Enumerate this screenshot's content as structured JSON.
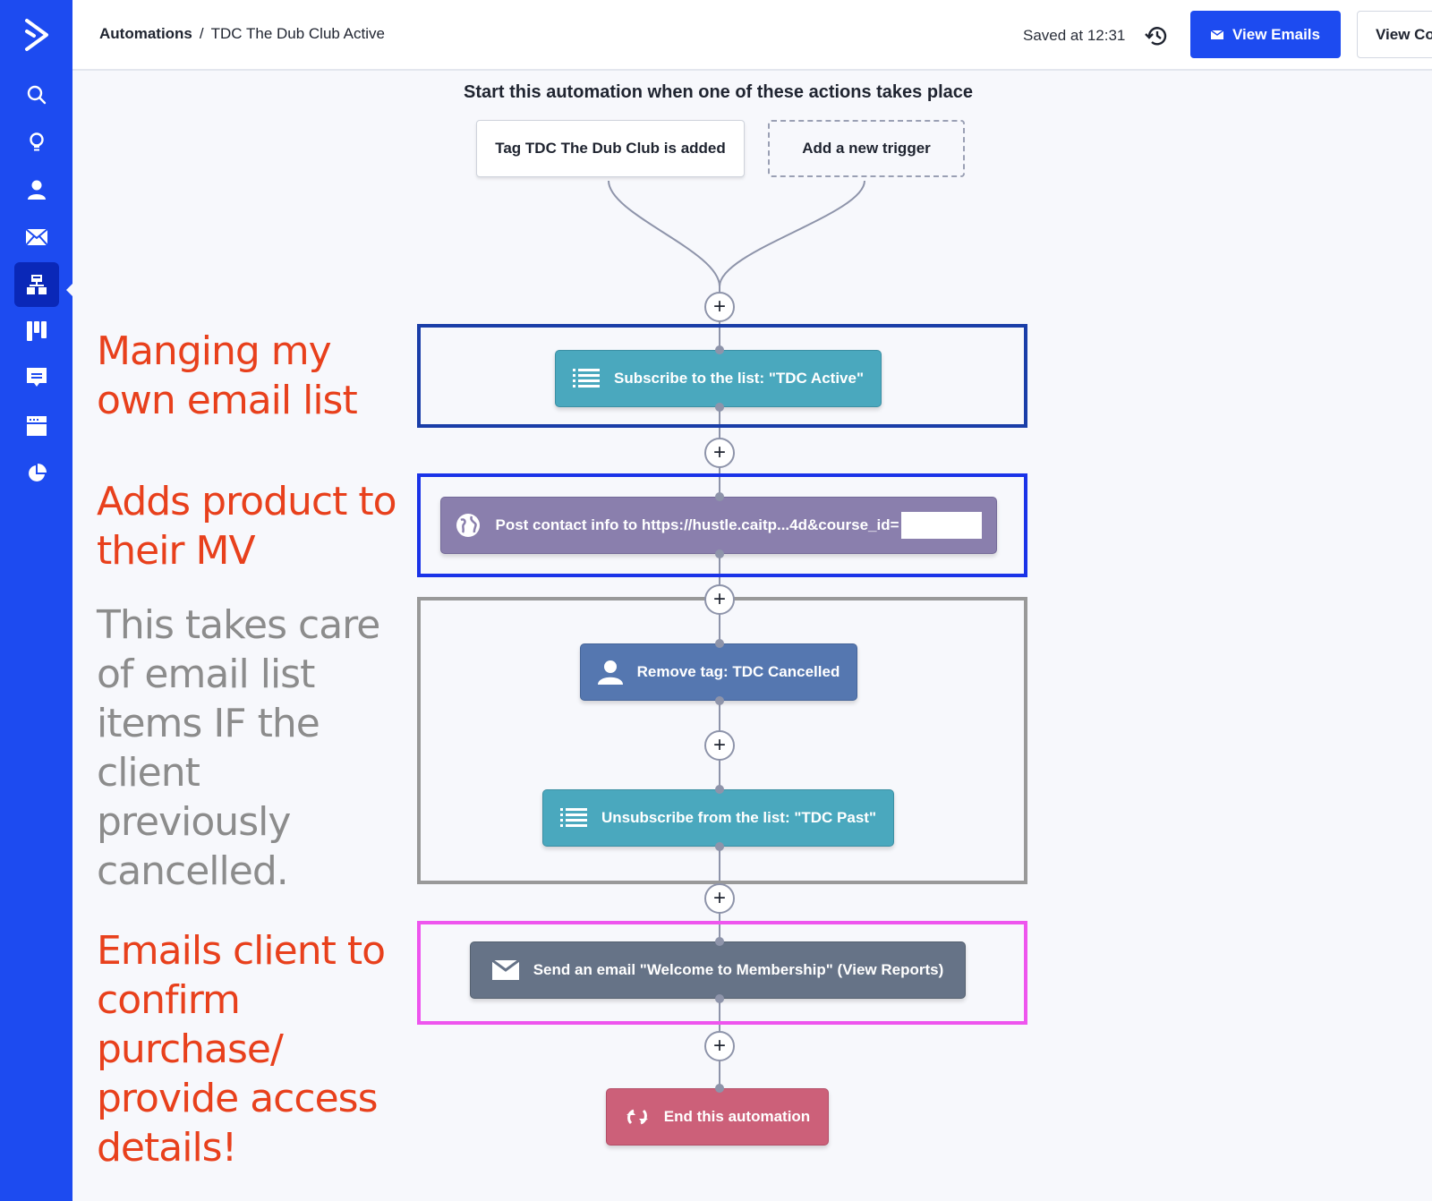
{
  "sidebar": {
    "logo": "activecampaign-logo",
    "items": [
      {
        "icon": "search-icon",
        "active": false
      },
      {
        "icon": "lightbulb-icon",
        "active": false
      },
      {
        "icon": "contacts-icon",
        "active": false
      },
      {
        "icon": "campaigns-icon",
        "active": false
      },
      {
        "icon": "automations-icon",
        "active": true
      },
      {
        "icon": "deals-icon",
        "active": false
      },
      {
        "icon": "conversations-icon",
        "active": false
      },
      {
        "icon": "website-icon",
        "active": false
      },
      {
        "icon": "reports-icon",
        "active": false
      }
    ]
  },
  "header": {
    "breadcrumb_root": "Automations",
    "breadcrumb_sep": "/",
    "breadcrumb_current": "TDC The Dub Club Active",
    "saved_text": "Saved at 12:31",
    "view_emails_label": "View Emails",
    "view_contacts_label": "View Co"
  },
  "canvas": {
    "title": "Start this automation when one of these actions takes place",
    "triggers": [
      {
        "label": "Tag TDC The Dub Club is added"
      },
      {
        "label": "Add a new trigger"
      }
    ],
    "actions": [
      {
        "label": "Subscribe to the list: \"TDC Active\"",
        "icon": "list-icon",
        "color": "#4aa8be"
      },
      {
        "label": "Post contact info to https://hustle.caitp...4d&course_id=",
        "icon": "globe-icon",
        "color": "#8a7fad"
      },
      {
        "label": "Remove tag: TDC Cancelled",
        "icon": "user-icon",
        "color": "#5577b0"
      },
      {
        "label": "Unsubscribe from the list: \"TDC Past\"",
        "icon": "list-icon",
        "color": "#4aa8be"
      },
      {
        "label": "Send an email \"Welcome to Membership\" (View Reports)",
        "icon": "envelope-icon",
        "color": "#667387"
      },
      {
        "label": "End this automation",
        "icon": "end-icon",
        "color": "#cc6079"
      }
    ],
    "plus_symbol": "+"
  },
  "annotations": [
    {
      "text": "Manging my own email list",
      "color": "#e8401c",
      "box_color": "#1a3ea8"
    },
    {
      "text": "Adds product to their MV",
      "color": "#e8401c",
      "box_color": "#1a33e8"
    },
    {
      "text": "This takes care of email list items IF the client previously cancelled.",
      "color": "#8c8c8c",
      "box_color": "#999999"
    },
    {
      "text": "Emails client to confirm purchase/ provide access details!",
      "color": "#e8401c",
      "box_color": "#ee55ee"
    }
  ]
}
